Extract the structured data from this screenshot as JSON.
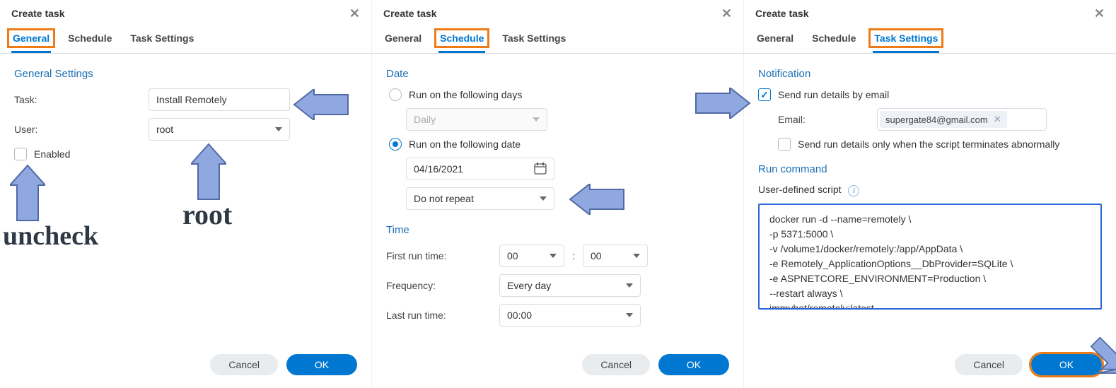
{
  "window_title": "Create task",
  "tabs": {
    "general": "General",
    "schedule": "Schedule",
    "task_settings": "Task Settings"
  },
  "buttons": {
    "cancel": "Cancel",
    "ok": "OK"
  },
  "general": {
    "section": "General Settings",
    "task_label": "Task:",
    "task_value": "Install Remotely",
    "user_label": "User:",
    "user_value": "root",
    "enabled_label": "Enabled",
    "annot_uncheck": "uncheck",
    "annot_root": "root"
  },
  "schedule": {
    "date_section": "Date",
    "run_days": "Run on the following days",
    "daily": "Daily",
    "run_date": "Run on the following date",
    "date_value": "04/16/2021",
    "repeat_value": "Do not repeat",
    "time_section": "Time",
    "first_run": "First run time:",
    "hr": "00",
    "mn": "00",
    "freq_label": "Frequency:",
    "freq_value": "Every day",
    "last_run": "Last run time:",
    "last_value": "00:00"
  },
  "settings": {
    "notif_section": "Notification",
    "send_email": "Send run details by email",
    "email_label": "Email:",
    "email_value": "supergate84@gmail.com",
    "abnormal": "Send run details only when the script terminates abnormally",
    "run_section": "Run command",
    "script_label": "User-defined script",
    "script": "docker run -d --name=remotely \\\n-p 5371:5000 \\\n-v /volume1/docker/remotely:/app/AppData \\\n-e Remotely_ApplicationOptions__DbProvider=SQLite \\\n-e ASPNETCORE_ENVIRONMENT=Production \\\n--restart always \\\nimmybot/remotely:latest"
  }
}
